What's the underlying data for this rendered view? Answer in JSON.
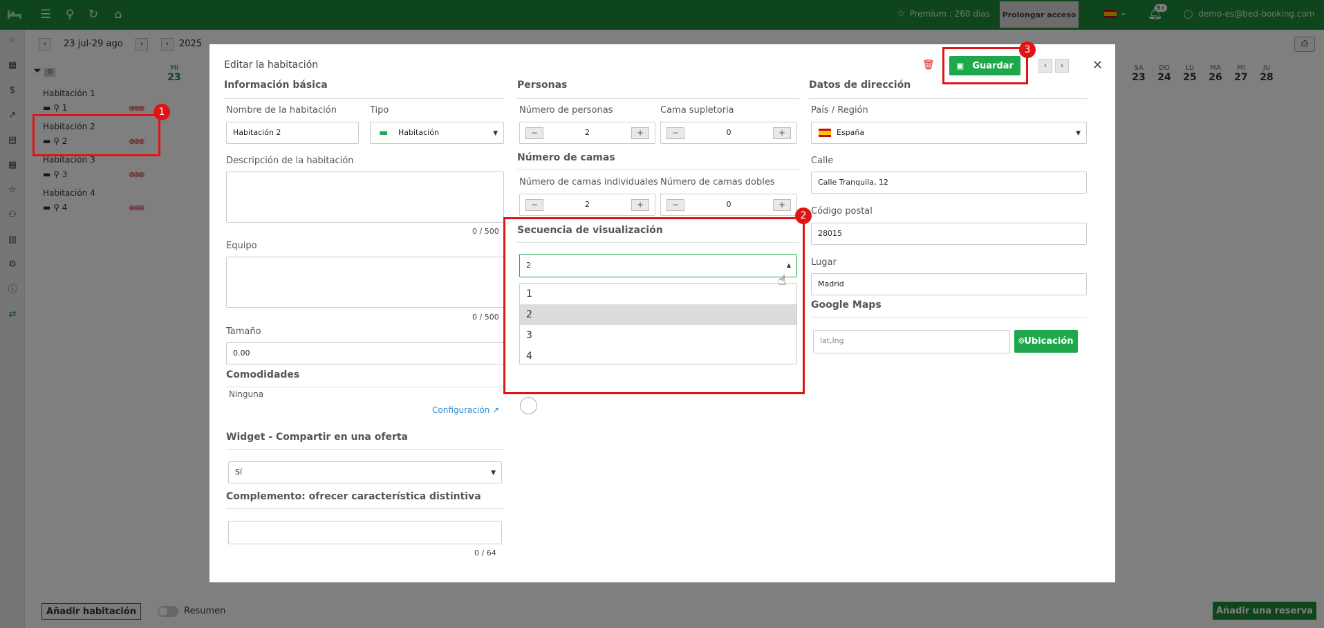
{
  "topbar": {
    "premium_text": "Premium : 260 días",
    "prolongar_label": "Prolongar acceso",
    "notifications_badge": "9+",
    "user_email": "demo-es@bed-booking.com",
    "brand_color": "#1f8b3a"
  },
  "calendar": {
    "range_label": "23 jul-29 ago",
    "year": "2025",
    "day_headers": [
      {
        "dow": "MI",
        "day": "23"
      },
      {
        "dow": "SA",
        "day": "23"
      },
      {
        "dow": "DO",
        "day": "24"
      },
      {
        "dow": "LU",
        "day": "25"
      },
      {
        "dow": "MA",
        "day": "26"
      },
      {
        "dow": "MI",
        "day": "27"
      },
      {
        "dow": "JU",
        "day": "28"
      }
    ],
    "filter_count": "0",
    "rooms": [
      {
        "name": "Habitación 1",
        "persons": "1"
      },
      {
        "name": "Habitación 2",
        "persons": "2"
      },
      {
        "name": "Habitación 3",
        "persons": "3"
      },
      {
        "name": "Habitación 4",
        "persons": "4"
      }
    ]
  },
  "bottom": {
    "add_room_label": "Añadir habitación",
    "summary_label": "Resumen",
    "add_reservation_label": "Añadir una reserva"
  },
  "modal": {
    "title": "Editar la habitación",
    "save_label": "Guardar",
    "basic": {
      "section": "Información básica",
      "name_label": "Nombre de la habitación",
      "name_value": "Habitación 2",
      "type_label": "Tipo",
      "type_value": "Habitación",
      "description_label": "Descripción de la habitación",
      "description_counter": "0 / 500",
      "equipment_label": "Equipo",
      "equipment_counter": "0 / 500",
      "size_label": "Tamaño",
      "size_value": "0.00",
      "amenities_section": "Comodidades",
      "amenities_value": "Ninguna",
      "config_link": "Configuración",
      "widget_section": "Widget - Compartir en una oferta",
      "widget_value": "Sí",
      "complement_section": "Complemento: ofrecer característica distintiva",
      "complement_counter": "0 / 64"
    },
    "persons": {
      "section": "Personas",
      "count_label": "Número de personas",
      "count_value": "2",
      "extra_bed_label": "Cama supletoria",
      "extra_bed_value": "0",
      "beds_section": "Número de camas",
      "single_label": "Número de camas individuales",
      "single_value": "2",
      "double_label": "Número de camas dobles",
      "double_value": "0",
      "display_section": "Secuencia de visualización",
      "display_value": "2",
      "display_options": [
        "1",
        "2",
        "3",
        "4"
      ]
    },
    "address": {
      "section": "Datos de dirección",
      "country_label": "País / Región",
      "country_value": "España",
      "street_label": "Calle",
      "street_value": "Calle Tranquila, 12",
      "postal_label": "Código postal",
      "postal_value": "28015",
      "city_label": "Lugar",
      "city_value": "Madrid",
      "maps_section": "Google Maps",
      "coords_placeholder": "lat,lng",
      "location_button": "Ubicación"
    }
  },
  "annotations": [
    "1",
    "2",
    "3"
  ]
}
